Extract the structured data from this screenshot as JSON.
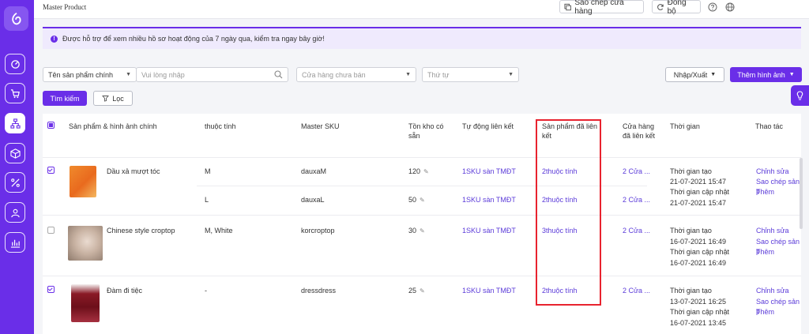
{
  "header": {
    "page_title": "Master Product",
    "copy_store_label": "Sao chép cửa hàng",
    "sync_label": "Đồng bộ"
  },
  "notice": {
    "text": "Được hỗ trợ để xem nhiều hồ sơ hoạt động của 7 ngày qua, kiểm tra ngay bây giờ!"
  },
  "filters": {
    "field_select": "Tên sản phẩm chính",
    "search_placeholder": "Vui lòng nhập",
    "store_placeholder": "Cửa hàng chưa bán",
    "order_placeholder": "Thứ tự",
    "search_button": "Tìm kiếm",
    "filter_button": "Lọc",
    "import_export": "Nhập/Xuất",
    "add_image": "Thêm hình ảnh"
  },
  "table": {
    "headers": {
      "product": "Sản phẩm & hình ảnh chính",
      "attribute": "thuộc tính",
      "sku": "Master SKU",
      "stock": "Tồn kho có sẵn",
      "auto_link": "Tự động liên kết",
      "linked_products": "Sản phẩm đã liên kết",
      "linked_stores": "Cửa hàng đã liên kết",
      "time": "Thời gian",
      "action": "Thao tác"
    },
    "rows": [
      {
        "name": "Dầu xả mượt tóc",
        "variants": [
          {
            "attr": "M",
            "sku": "dauxaM",
            "stock": "120",
            "auto": "1SKU sàn TMĐT",
            "linked": "2thuộc tính",
            "stores": "2 Cửa ..."
          },
          {
            "attr": "L",
            "sku": "dauxaL",
            "stock": "50",
            "auto": "1SKU sàn TMĐT",
            "linked": "2thuộc tính",
            "stores": "2 Cửa ..."
          }
        ],
        "created_label": "Thời gian tạo",
        "created": "21-07-2021 15:47",
        "updated_label": "Thời gian cập nhật",
        "updated": "21-07-2021 15:47",
        "actions": [
          "Chỉnh sửa",
          "Sao chép sản p",
          "Thêm"
        ]
      },
      {
        "name": "Chinese style croptop",
        "variants": [
          {
            "attr": "M, White",
            "sku": "korcroptop",
            "stock": "30",
            "auto": "1SKU sàn TMĐT",
            "linked": "3thuộc tính",
            "stores": "2 Cửa ..."
          }
        ],
        "created_label": "Thời gian tạo",
        "created": "16-07-2021 16:49",
        "updated_label": "Thời gian cập nhật",
        "updated": "16-07-2021 16:49",
        "actions": [
          "Chỉnh sửa",
          "Sao chép sản p",
          "Thêm"
        ]
      },
      {
        "name": "Đàm đi tiệc",
        "variants": [
          {
            "attr": "-",
            "sku": "dressdress",
            "stock": "25",
            "auto": "1SKU sàn TMĐT",
            "linked": "2thuộc tính",
            "stores": "2 Cửa ..."
          }
        ],
        "created_label": "Thời gian tạo",
        "created": "13-07-2021 16:25",
        "updated_label": "Thời gian cập nhật",
        "updated": "16-07-2021 13:45",
        "actions": [
          "Chỉnh sửa",
          "Sao chép sản p",
          "Thêm"
        ]
      }
    ]
  },
  "colors": {
    "brand": "#6a2ee8",
    "link": "#5b3bd9",
    "highlight": "#e8232f"
  }
}
